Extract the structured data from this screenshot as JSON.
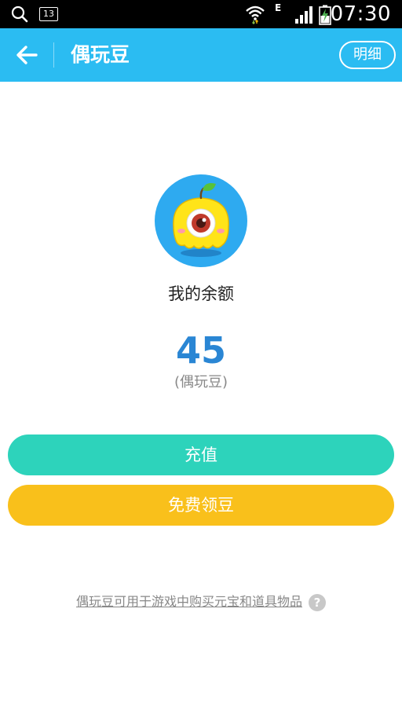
{
  "status_bar": {
    "notification_count": "13",
    "network_type": "E",
    "clock": "07:30"
  },
  "header": {
    "title": "偶玩豆",
    "detail_button": "明细"
  },
  "balance": {
    "label": "我的余额",
    "value": "45",
    "unit": "(偶玩豆)"
  },
  "actions": {
    "recharge": "充值",
    "free_beans": "免费领豆"
  },
  "footer": {
    "note": "偶玩豆可用于游戏中购买元宝和道具物品",
    "help_icon": "?"
  },
  "colors": {
    "app_bar": "#2bbcf2",
    "recharge_button": "#2dd3bb",
    "free_button": "#f9c01b",
    "balance_value": "#2a86d4"
  },
  "icons": {
    "back": "arrow-left",
    "avatar": "yellow-one-eyed-mascot",
    "help": "question-circle"
  }
}
